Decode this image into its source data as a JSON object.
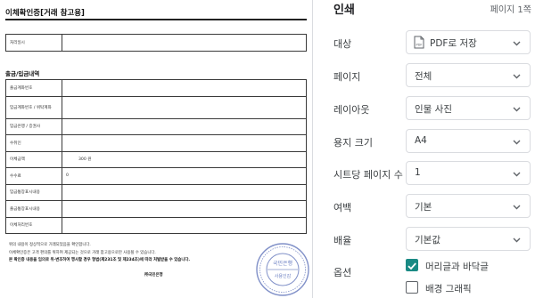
{
  "preview": {
    "title": "이체확인증[거래 참고용]",
    "date_label": "처리일시",
    "section_title": "출금/입금내역",
    "rows": [
      {
        "label": "출금계좌번호",
        "value": ""
      },
      {
        "label": "입금계좌번호 / 위탁계좌",
        "value": ""
      },
      {
        "label": "입금은행 / 증권사",
        "value": ""
      },
      {
        "label": "수취인",
        "value": ""
      },
      {
        "label": "이체금액",
        "value": "300 원"
      },
      {
        "label": "수수료",
        "value": "0"
      },
      {
        "label": "입금통장표시내용",
        "value": ""
      },
      {
        "label": "출금통장표시내용",
        "value": ""
      },
      {
        "label": "이체처리번호",
        "value": ""
      }
    ],
    "notes": [
      "위의 내용이 정상적으로 거래되었음을 확인합니다.",
      "이체확인증은 고객 편의를 위하여 제공되는 것으로 거래 참고용으로만 사용될 수 있습니다.",
      "본 확인증 내용을 임의로 위·변조하여 행사할 경우 형법(제231조 및 제234조)에 따라 처벌받을 수 있습니다."
    ],
    "issuer": "㈜국민은행",
    "seal_text_top": "국민은행",
    "seal_text_bottom": "사용인감"
  },
  "print_settings": {
    "title": "인쇄",
    "page_count": "페이지 1쪽",
    "destination": {
      "label": "대상",
      "value": "PDF로 저장",
      "icon": "pdf-file-icon"
    },
    "pages": {
      "label": "페이지",
      "value": "전체"
    },
    "layout": {
      "label": "레이아웃",
      "value": "인물 사진"
    },
    "paper_size": {
      "label": "용지 크기",
      "value": "A4"
    },
    "pages_per_sheet": {
      "label": "시트당 페이지 수",
      "value": "1"
    },
    "margins": {
      "label": "여백",
      "value": "기본"
    },
    "scale": {
      "label": "배율",
      "value": "기본값"
    },
    "options": {
      "label": "옵션",
      "headers_footers": {
        "label": "머리글과 바닥글",
        "checked": true
      },
      "background_graphics": {
        "label": "배경 그래픽",
        "checked": false
      }
    }
  },
  "colors": {
    "accent": "#1a8a84",
    "seal": "#8090c8",
    "border": "#dadce0"
  }
}
